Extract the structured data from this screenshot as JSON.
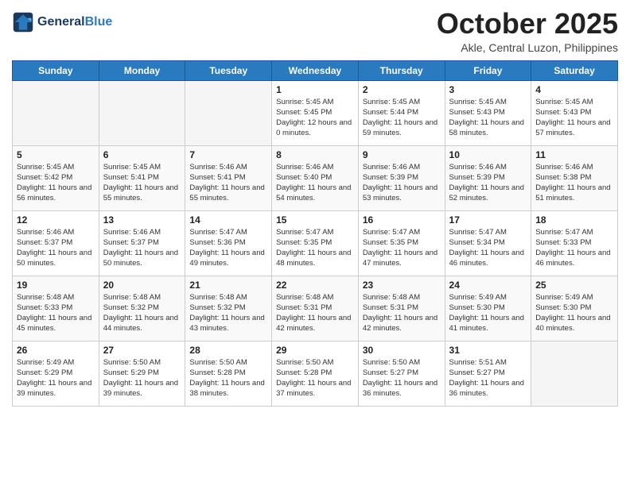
{
  "header": {
    "logo_line1": "General",
    "logo_line2": "Blue",
    "month": "October 2025",
    "location": "Akle, Central Luzon, Philippines"
  },
  "weekdays": [
    "Sunday",
    "Monday",
    "Tuesday",
    "Wednesday",
    "Thursday",
    "Friday",
    "Saturday"
  ],
  "weeks": [
    [
      {
        "day": "",
        "sunrise": "",
        "sunset": "",
        "daylight": ""
      },
      {
        "day": "",
        "sunrise": "",
        "sunset": "",
        "daylight": ""
      },
      {
        "day": "",
        "sunrise": "",
        "sunset": "",
        "daylight": ""
      },
      {
        "day": "1",
        "sunrise": "Sunrise: 5:45 AM",
        "sunset": "Sunset: 5:45 PM",
        "daylight": "Daylight: 12 hours and 0 minutes."
      },
      {
        "day": "2",
        "sunrise": "Sunrise: 5:45 AM",
        "sunset": "Sunset: 5:44 PM",
        "daylight": "Daylight: 11 hours and 59 minutes."
      },
      {
        "day": "3",
        "sunrise": "Sunrise: 5:45 AM",
        "sunset": "Sunset: 5:43 PM",
        "daylight": "Daylight: 11 hours and 58 minutes."
      },
      {
        "day": "4",
        "sunrise": "Sunrise: 5:45 AM",
        "sunset": "Sunset: 5:43 PM",
        "daylight": "Daylight: 11 hours and 57 minutes."
      }
    ],
    [
      {
        "day": "5",
        "sunrise": "Sunrise: 5:45 AM",
        "sunset": "Sunset: 5:42 PM",
        "daylight": "Daylight: 11 hours and 56 minutes."
      },
      {
        "day": "6",
        "sunrise": "Sunrise: 5:45 AM",
        "sunset": "Sunset: 5:41 PM",
        "daylight": "Daylight: 11 hours and 55 minutes."
      },
      {
        "day": "7",
        "sunrise": "Sunrise: 5:46 AM",
        "sunset": "Sunset: 5:41 PM",
        "daylight": "Daylight: 11 hours and 55 minutes."
      },
      {
        "day": "8",
        "sunrise": "Sunrise: 5:46 AM",
        "sunset": "Sunset: 5:40 PM",
        "daylight": "Daylight: 11 hours and 54 minutes."
      },
      {
        "day": "9",
        "sunrise": "Sunrise: 5:46 AM",
        "sunset": "Sunset: 5:39 PM",
        "daylight": "Daylight: 11 hours and 53 minutes."
      },
      {
        "day": "10",
        "sunrise": "Sunrise: 5:46 AM",
        "sunset": "Sunset: 5:39 PM",
        "daylight": "Daylight: 11 hours and 52 minutes."
      },
      {
        "day": "11",
        "sunrise": "Sunrise: 5:46 AM",
        "sunset": "Sunset: 5:38 PM",
        "daylight": "Daylight: 11 hours and 51 minutes."
      }
    ],
    [
      {
        "day": "12",
        "sunrise": "Sunrise: 5:46 AM",
        "sunset": "Sunset: 5:37 PM",
        "daylight": "Daylight: 11 hours and 50 minutes."
      },
      {
        "day": "13",
        "sunrise": "Sunrise: 5:46 AM",
        "sunset": "Sunset: 5:37 PM",
        "daylight": "Daylight: 11 hours and 50 minutes."
      },
      {
        "day": "14",
        "sunrise": "Sunrise: 5:47 AM",
        "sunset": "Sunset: 5:36 PM",
        "daylight": "Daylight: 11 hours and 49 minutes."
      },
      {
        "day": "15",
        "sunrise": "Sunrise: 5:47 AM",
        "sunset": "Sunset: 5:35 PM",
        "daylight": "Daylight: 11 hours and 48 minutes."
      },
      {
        "day": "16",
        "sunrise": "Sunrise: 5:47 AM",
        "sunset": "Sunset: 5:35 PM",
        "daylight": "Daylight: 11 hours and 47 minutes."
      },
      {
        "day": "17",
        "sunrise": "Sunrise: 5:47 AM",
        "sunset": "Sunset: 5:34 PM",
        "daylight": "Daylight: 11 hours and 46 minutes."
      },
      {
        "day": "18",
        "sunrise": "Sunrise: 5:47 AM",
        "sunset": "Sunset: 5:33 PM",
        "daylight": "Daylight: 11 hours and 46 minutes."
      }
    ],
    [
      {
        "day": "19",
        "sunrise": "Sunrise: 5:48 AM",
        "sunset": "Sunset: 5:33 PM",
        "daylight": "Daylight: 11 hours and 45 minutes."
      },
      {
        "day": "20",
        "sunrise": "Sunrise: 5:48 AM",
        "sunset": "Sunset: 5:32 PM",
        "daylight": "Daylight: 11 hours and 44 minutes."
      },
      {
        "day": "21",
        "sunrise": "Sunrise: 5:48 AM",
        "sunset": "Sunset: 5:32 PM",
        "daylight": "Daylight: 11 hours and 43 minutes."
      },
      {
        "day": "22",
        "sunrise": "Sunrise: 5:48 AM",
        "sunset": "Sunset: 5:31 PM",
        "daylight": "Daylight: 11 hours and 42 minutes."
      },
      {
        "day": "23",
        "sunrise": "Sunrise: 5:48 AM",
        "sunset": "Sunset: 5:31 PM",
        "daylight": "Daylight: 11 hours and 42 minutes."
      },
      {
        "day": "24",
        "sunrise": "Sunrise: 5:49 AM",
        "sunset": "Sunset: 5:30 PM",
        "daylight": "Daylight: 11 hours and 41 minutes."
      },
      {
        "day": "25",
        "sunrise": "Sunrise: 5:49 AM",
        "sunset": "Sunset: 5:30 PM",
        "daylight": "Daylight: 11 hours and 40 minutes."
      }
    ],
    [
      {
        "day": "26",
        "sunrise": "Sunrise: 5:49 AM",
        "sunset": "Sunset: 5:29 PM",
        "daylight": "Daylight: 11 hours and 39 minutes."
      },
      {
        "day": "27",
        "sunrise": "Sunrise: 5:50 AM",
        "sunset": "Sunset: 5:29 PM",
        "daylight": "Daylight: 11 hours and 39 minutes."
      },
      {
        "day": "28",
        "sunrise": "Sunrise: 5:50 AM",
        "sunset": "Sunset: 5:28 PM",
        "daylight": "Daylight: 11 hours and 38 minutes."
      },
      {
        "day": "29",
        "sunrise": "Sunrise: 5:50 AM",
        "sunset": "Sunset: 5:28 PM",
        "daylight": "Daylight: 11 hours and 37 minutes."
      },
      {
        "day": "30",
        "sunrise": "Sunrise: 5:50 AM",
        "sunset": "Sunset: 5:27 PM",
        "daylight": "Daylight: 11 hours and 36 minutes."
      },
      {
        "day": "31",
        "sunrise": "Sunrise: 5:51 AM",
        "sunset": "Sunset: 5:27 PM",
        "daylight": "Daylight: 11 hours and 36 minutes."
      },
      {
        "day": "",
        "sunrise": "",
        "sunset": "",
        "daylight": ""
      }
    ]
  ]
}
